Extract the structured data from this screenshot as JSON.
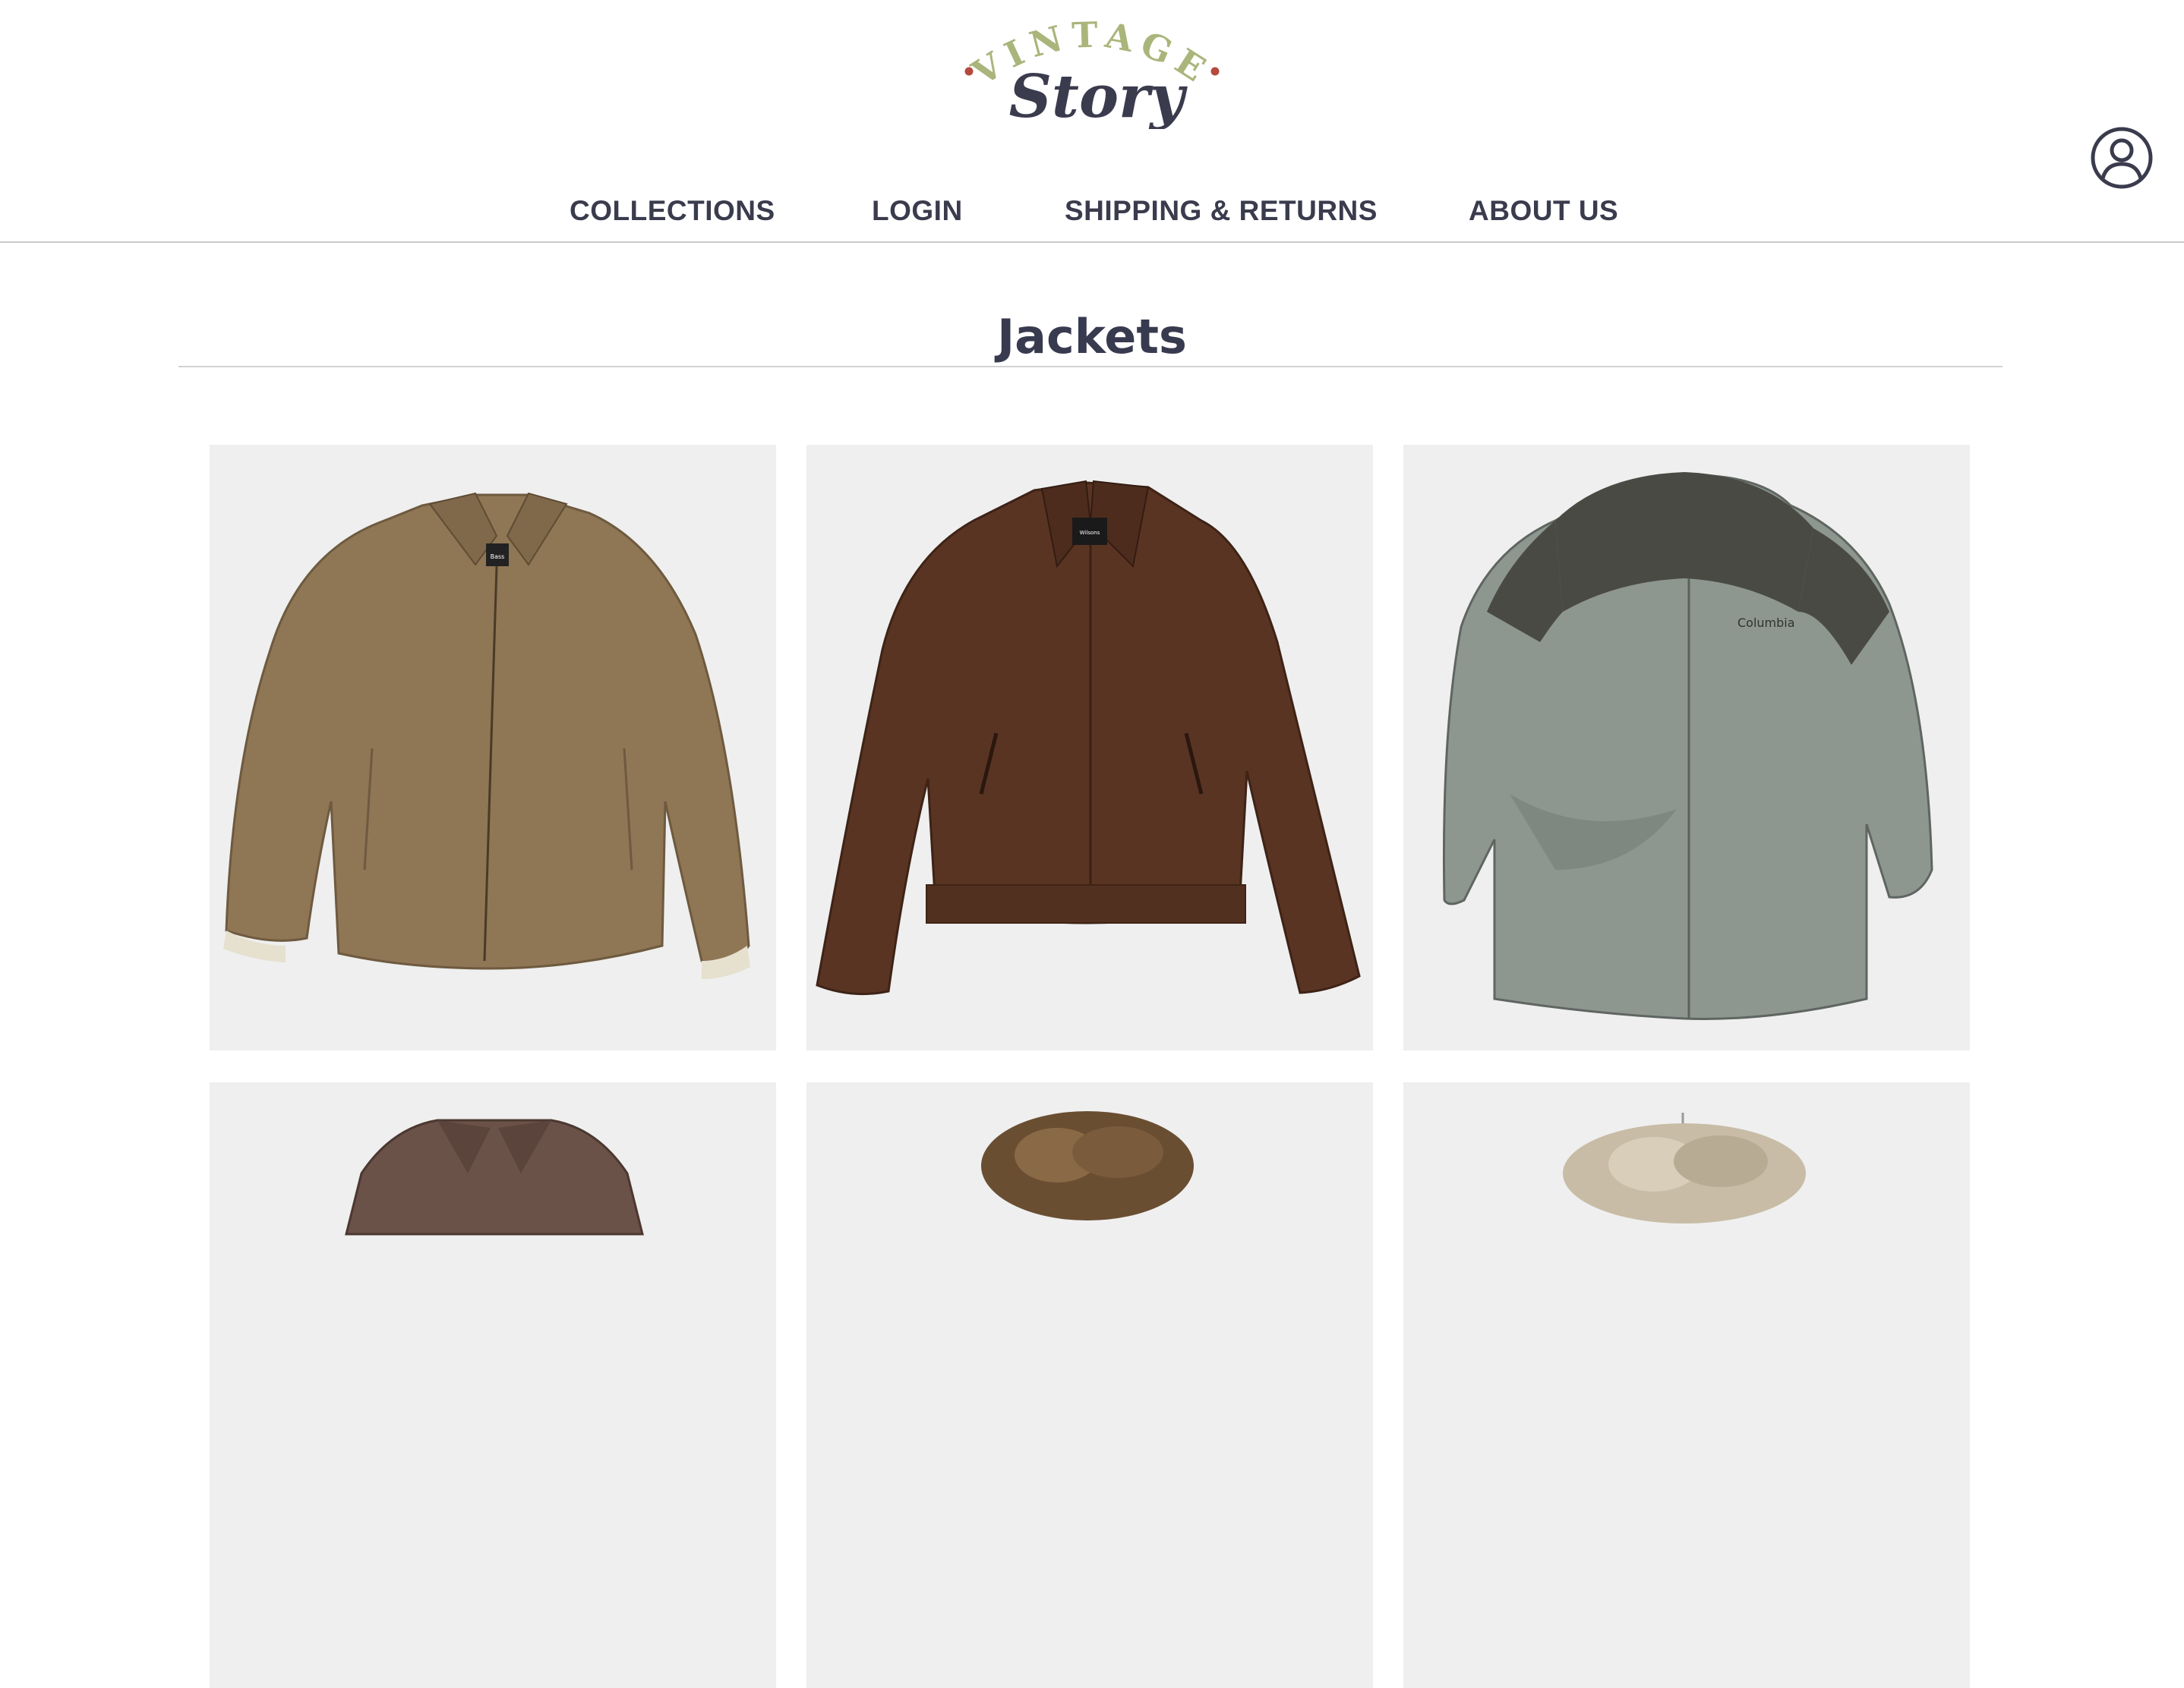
{
  "brand": {
    "logo_top": "VINTAGE",
    "logo_bottom": "Story"
  },
  "nav": {
    "collections": "COLLECTIONS",
    "login": "LOGIN",
    "shipping": "SHIPPING & RETURNS",
    "about": "ABOUT US"
  },
  "page": {
    "title": "Jackets"
  },
  "products": [
    {
      "image": "tan-zip-jacket",
      "label": "Bass"
    },
    {
      "image": "brown-suede-jacket",
      "label": "Wilsons"
    },
    {
      "image": "grey-columbia-rain-jacket",
      "label": "Columbia"
    },
    {
      "image": "brown-leather-jacket"
    },
    {
      "image": "fur-collar-jacket"
    },
    {
      "image": "shearling-jacket"
    }
  ],
  "colors": {
    "text": "#3a3b4d",
    "logo_green": "#a9b57a",
    "logo_dot": "#b5493e",
    "card_bg": "#efefef"
  },
  "icons": {
    "account": "user-circle-icon"
  }
}
